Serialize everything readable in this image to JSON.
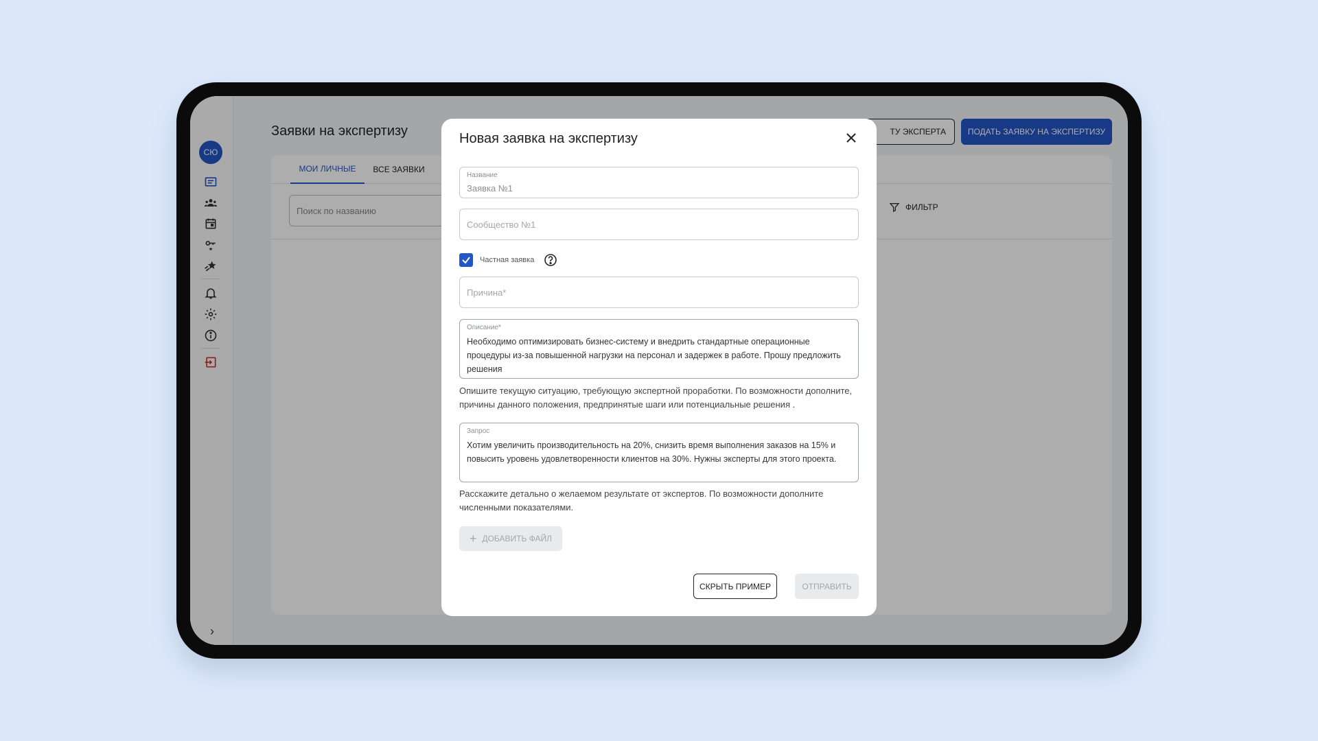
{
  "sidebar": {
    "avatar_initials": "СЮ",
    "icons": [
      "folder-icon",
      "users-icon",
      "calendar-icon",
      "key-icon",
      "star-icon",
      "bell-icon",
      "gear-icon",
      "info-icon",
      "logout-icon"
    ],
    "expand_icon": "chevron-right-icon"
  },
  "header": {
    "title": "Заявки на экспертизу",
    "expert_button_label": "ТУ ЭКСПЕРТА",
    "submit_button_label": "ПОДАТЬ ЗАЯВКУ НА ЭКСПЕРТИЗУ"
  },
  "tabs": [
    {
      "label": "МОИ ЛИЧНЫЕ",
      "active": true
    },
    {
      "label": "ВСЕ ЗАЯВКИ",
      "active": false
    }
  ],
  "search": {
    "placeholder": "Поиск по названию"
  },
  "filter": {
    "label": "ФИЛЬТР"
  },
  "modal": {
    "title": "Новая заявка на экспертизу",
    "name_field": {
      "label": "Название",
      "value": "Заявка №1"
    },
    "community_field": {
      "placeholder": "Сообщество №1"
    },
    "private_checkbox": {
      "label": "Частная заявка",
      "checked": true
    },
    "reason_field": {
      "placeholder": "Причина*"
    },
    "description_field": {
      "label": "Описание*",
      "value": "Необходимо оптимизировать бизнес-систему и внедрить стандартные операционные процедуры из-за повышенной нагрузки на персонал и задержек в работе. Прошу предложить решения"
    },
    "description_hint": "Опишите текущую ситуацию, требующую экспертной проработки. По возможности дополните, причины данного положения, предпринятые шаги или потенциальные решения .",
    "request_field": {
      "label": "Запрос",
      "value": "Хотим увеличить производительность на 20%, снизить время выполнения заказов на 15% и повысить уровень удовлетворенности клиентов на 30%. Нужны эксперты для этого проекта."
    },
    "request_hint": "Расскажите детально о желаемом результате от экспертов. По возможности дополните численными показателями.",
    "add_file_label": "ДОБАВИТЬ ФАЙЛ",
    "hide_example_label": "СКРЫТЬ ПРИМЕР",
    "send_label": "ОТПРАВИТЬ"
  },
  "colors": {
    "accent": "#2456c6",
    "logout": "#d32f2f",
    "background": "#dde9fb"
  }
}
